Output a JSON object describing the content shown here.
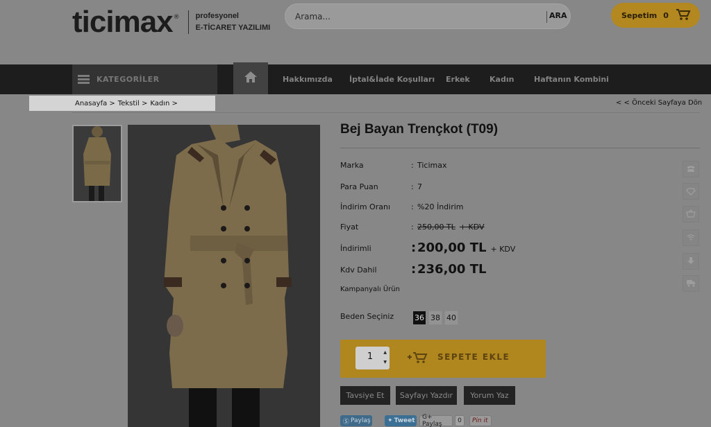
{
  "header": {
    "logo_text": "ticimax",
    "logo_reg": "®",
    "tagline_1": "profesyonel",
    "tagline_2": "E-TİCARET YAZILIMI",
    "search_placeholder": "Arama...",
    "search_button": "ARA",
    "cart_label": "Sepetim",
    "cart_count": "0"
  },
  "nav": {
    "categories_label": "KATEGORİLER",
    "items": [
      "Hakkımızda",
      "İptal&İade Koşulları",
      "Erkek",
      "Kadın",
      "Haftanın Kombini"
    ]
  },
  "breadcrumb": [
    "Anasayfa >",
    "Tekstil >",
    "Kadın >"
  ],
  "back_link": "< < Önceki Sayfaya Dön",
  "product": {
    "title": "Bej Bayan Trençkot (T09)",
    "rows": [
      {
        "label": "Marka",
        "value": "Ticimax"
      },
      {
        "label": "Para Puan",
        "value": "7"
      },
      {
        "label": "İndirim Oranı",
        "value": "%20 İndirim"
      }
    ],
    "price_label": "Fiyat",
    "old_price": "250,00 TL",
    "old_price_kdv": "+ KDV",
    "discount_label": "İndirimli",
    "discount_price": "200,00 TL",
    "discount_kdv": "+ KDV",
    "incl_label": "Kdv Dahil",
    "incl_price": "236,00 TL",
    "campaign": "Kampanyalı Ürün",
    "colon": ":",
    "size_label": "Beden Seçiniz",
    "sizes": [
      "36",
      "38",
      "40"
    ],
    "selected_size": "36",
    "quantity": "1",
    "add_to_cart": "SEPETE EKLE",
    "actions": [
      "Tavsiye Et",
      "Sayfayı Yazdır",
      "Yorum Yaz"
    ]
  },
  "social": {
    "skype": "Paylaş",
    "tweet": "Tweet",
    "gplus": "G+ Paylaş",
    "gplus_count": "0",
    "pinterest": "Pin it"
  },
  "colors": {
    "accent": "#b0871e",
    "nav_bg": "#1d1d1d",
    "overlay_bg": "#878787"
  }
}
